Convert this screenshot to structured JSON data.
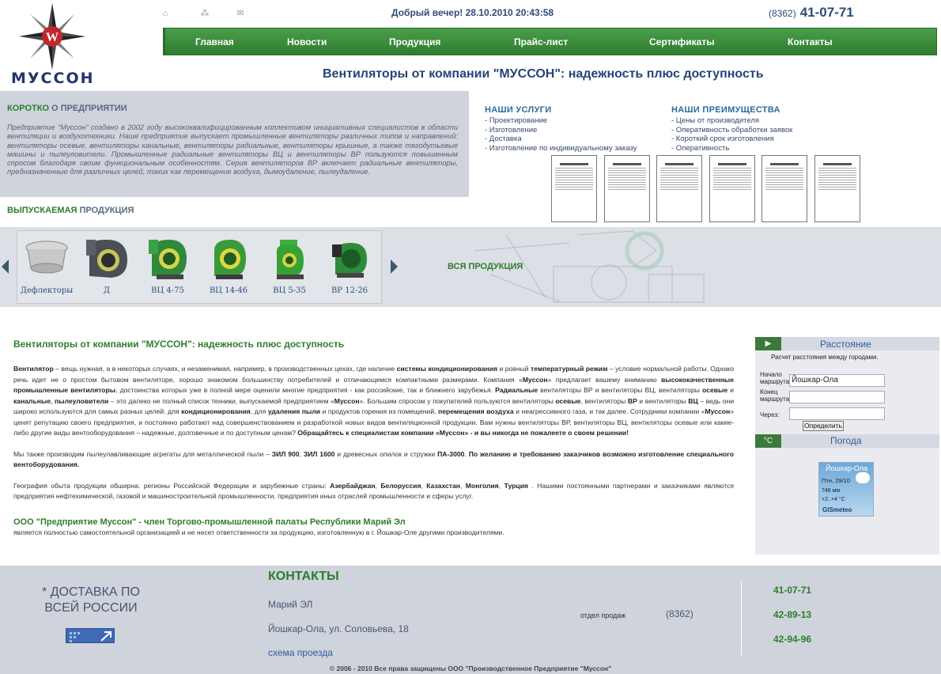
{
  "header": {
    "logo_text": "МУССОН",
    "greeting": "Добрый вечер! 28.10.2010 20:43:58",
    "phone_code": "(8362)",
    "phone_number": "41-07-71",
    "title": "Вентиляторы от компании \"МУССОН\": надежность плюс доступность"
  },
  "nav": [
    "Главная",
    "Новости",
    "Продукция",
    "Прайс-лист",
    "Сертификаты",
    "Контакты"
  ],
  "about": {
    "head_green": "КОРОТКО",
    "head_gray": "О ПРЕДПРИЯТИИ",
    "text": "Предприятие “Муссон” создано в 2002 году высококвалифицированным коллективом инициативных специалистов в области вентиляции и воздухотехники. Наше предприятие выпускает промышленные вентиляторы различных типов и направлений: вентиляторы осевые, вентиляторы канальные, вентиляторы радиальные, вентиляторы крышные, а также тягодутьевые машины и пылеуловители. Промышленные радиальные вентиляторы ВЦ и вентиляторы ВР пользуются повышенным спросом благодаря своим функциональным особенностям. Серия вентиляторов ВР включает радиальные вентиляторы, предназначенные для различных целей, таких как перемещение воздуха, дымоудаление, пылеудаление."
  },
  "products_head": {
    "green": "ВЫПУСКАЕМАЯ",
    "gray": "ПРОДУКЦИЯ"
  },
  "services": {
    "title": "НАШИ УСЛУГИ",
    "items": [
      "- Проектирование",
      "- Изготовление",
      "- Доставка",
      "- Изготовление по индивидуальному заказу"
    ]
  },
  "advantages": {
    "title": "НАШИ ПРЕИМУЩЕСТВА",
    "items": [
      "- Цены от производителя",
      "- Оперативность обработки заявок",
      "- Короткий срок изготовления",
      "- Оперативность"
    ]
  },
  "products": [
    "Дефлекторы",
    "Д",
    "ВЦ 4-75",
    "ВЦ 14-46",
    "ВЦ 5-35",
    "ВР 12-26"
  ],
  "all_products": "ВСЯ ПРОДУКЦИЯ",
  "main": {
    "title": "Вентиляторы от компании \"МУССОН\": надежность плюс доступность",
    "member_title": "ООО \"Предприятие Муссон\" - член Торгово-промышленной палаты Республики Марий Эл",
    "member_text": "является полностью самостоятельной организацией и не несет ответственности за продукцию, изготовленную в г. Йошкар-Оле другими производителями."
  },
  "distance": {
    "tag": "▶",
    "title": "Расстояние",
    "subtitle": "Расчет расстояния между городами.",
    "start_label": "Начало маршрута:",
    "start_value": "Йошкар-Ола",
    "end_label": "Конец маршрута:",
    "via_label": "Через:",
    "button": "Определить"
  },
  "weather": {
    "tag": "°С",
    "title": "Погода",
    "city": "Йошкар-Ола",
    "date": "Птн, 29/10",
    "pressure": "746 мм",
    "temp": "+2..+4 °C",
    "brand": "GISmeteo"
  },
  "footer": {
    "delivery": "* ДОСТАВКА ПО ВСЕЙ РОССИИ",
    "contacts_title": "КОНТАКТЫ",
    "region": "Марий ЭЛ",
    "address": "Йошкар-Ола, ул. Соловьева, 18",
    "route": "схема проезда",
    "sales_label": "отдел продаж",
    "sales_code": "(8362)",
    "phones": [
      "41-07-71",
      "42-89-13",
      "42-94-96"
    ],
    "copyright": "© 2006 - 2010 Все права защищены ООО \"Производственное Предприятие \"Муссон\""
  }
}
